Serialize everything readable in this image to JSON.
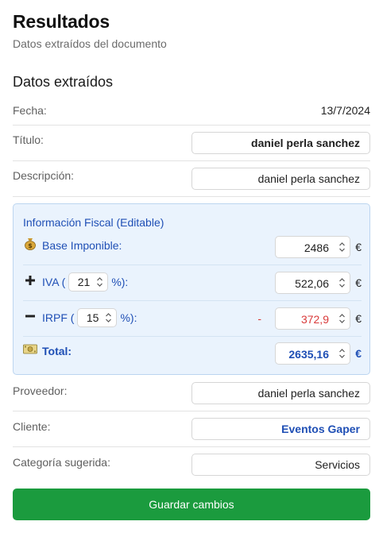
{
  "header": {
    "title": "Resultados",
    "subtitle": "Datos extraídos del documento"
  },
  "section": {
    "title": "Datos extraídos"
  },
  "fields": {
    "fecha": {
      "label": "Fecha:",
      "value": "13/7/2024"
    },
    "titulo": {
      "label": "Título:",
      "value": "daniel perla sanchez"
    },
    "descripcion": {
      "label": "Descripción:",
      "value": "daniel perla sanchez"
    },
    "proveedor": {
      "label": "Proveedor:",
      "value": "daniel perla sanchez"
    },
    "cliente": {
      "label": "Cliente:",
      "value": "Eventos Gaper"
    },
    "categoria": {
      "label": "Categoría sugerida:",
      "value": "Servicios"
    }
  },
  "fiscal": {
    "title": "Información Fiscal (Editable)",
    "currency": "€",
    "base": {
      "icon": "money-bag-icon",
      "label": "Base Imponible:",
      "value": "2486"
    },
    "iva": {
      "icon": "plus-icon",
      "label_prefix": "IVA (",
      "rate": "21",
      "label_suffix": "%):",
      "value": "522,06"
    },
    "irpf": {
      "icon": "minus-icon",
      "label_prefix": "IRPF (",
      "rate": "15",
      "label_suffix": "%):",
      "sign": "-",
      "value": "372,9"
    },
    "total": {
      "icon": "cash-icon",
      "label": "Total:",
      "value": "2635,16"
    }
  },
  "actions": {
    "save_label": "Guardar cambios"
  },
  "colors": {
    "accent_blue": "#1f4fb5",
    "save_green": "#1b9b3e",
    "negative_red": "#d93a3a",
    "fiscal_bg": "#eaf3fd"
  }
}
